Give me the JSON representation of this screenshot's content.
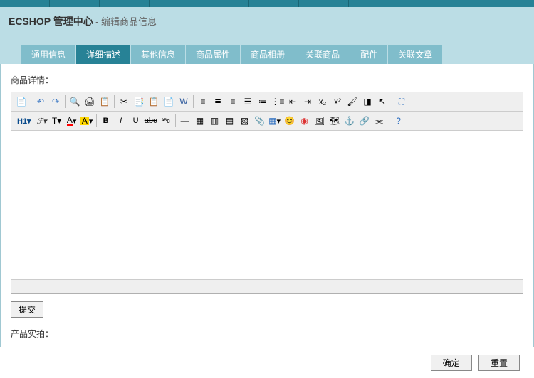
{
  "header": {
    "title": "ECSHOP 管理中心",
    "sub": "- 编辑商品信息"
  },
  "tabs": [
    "通用信息",
    "详细描述",
    "其他信息",
    "商品属性",
    "商品相册",
    "关联商品",
    "配件",
    "关联文章"
  ],
  "active_tab": 1,
  "labels": {
    "detail": "商品详情：",
    "photo": "产品实拍："
  },
  "buttons": {
    "submit": "提交",
    "ok": "确定",
    "reset": "重置"
  },
  "toolbar1": [
    "source",
    "undo",
    "redo",
    "zoomin",
    "zoomout",
    "print",
    "template",
    "cut",
    "copy",
    "paste",
    "pastetext",
    "pasteword",
    "align-left",
    "align-center",
    "align-right",
    "align-justify",
    "list-ol",
    "list-ul",
    "outdent",
    "indent",
    "subscript",
    "superscript",
    "brush",
    "eraser",
    "select",
    "fullscreen"
  ],
  "toolbar2": [
    "heading",
    "fontfamily",
    "fontsize",
    "fontcolor",
    "bgcolor",
    "bold",
    "italic",
    "underline",
    "strike",
    "abc",
    "hr",
    "table-insert",
    "table-edit",
    "table-del",
    "table-props",
    "attachment",
    "table",
    "emoji",
    "flash",
    "image",
    "anchor",
    "link",
    "unlink",
    "help"
  ]
}
